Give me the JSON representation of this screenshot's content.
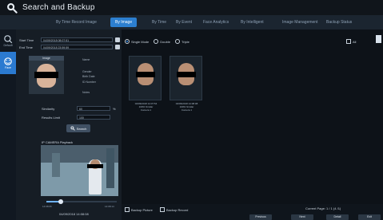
{
  "header": {
    "title": "Search and Backup"
  },
  "tabs": [
    "By Time Record Image",
    "By Image",
    "By Time",
    "By Event",
    "Face Analytics",
    "By Intelligent",
    "Image Management",
    "Backup Status"
  ],
  "left_rail": {
    "items": [
      {
        "label": "Default"
      },
      {
        "label": "Face"
      }
    ]
  },
  "panel": {
    "start_time_label": "Start Time",
    "start_time_value": "04/09/2018 08:07:51",
    "end_time_label": "End Time",
    "end_time_value": "04/09/2018 23:59:59",
    "photo_tab": "Image",
    "info_lines": [
      "Name",
      "",
      "Gender",
      "Birth Date",
      "ID Number",
      "",
      "Notes"
    ],
    "similarity_label": "Similarity",
    "similarity_value": "60",
    "similarity_unit": "%",
    "results_limit_label": "Results Limit",
    "results_limit_value": "100",
    "search_button": "Search",
    "playback_title": "IP CAMERA Playback",
    "timestamp_left": "14:08:06",
    "timestamp_right": "14:08:14",
    "timestamp_bottom": "04/09/2018 14:08:08"
  },
  "main": {
    "radios": [
      {
        "label": "Single Mode",
        "checked": true
      },
      {
        "label": "Double",
        "checked": false
      },
      {
        "label": "Triple",
        "checked": false
      }
    ],
    "all_label": "All",
    "thumbnails": [
      {
        "caption_line1": "04/09/2018 14:07:54",
        "caption_line2": "100% Similar",
        "caption_line3": "Camera 1"
      },
      {
        "caption_line1": "04/09/2018 14:08:08",
        "caption_line2": "100% Similar",
        "caption_line3": "Camera 1"
      }
    ],
    "bottom": {
      "backup_picture_label": "Backup Picture",
      "backup_record_label": "Backup Record",
      "current_page": "Current Page: 1 / 1 (4 /1)",
      "buttons": [
        "Previous",
        "Next",
        "Detail",
        "Exit"
      ]
    }
  }
}
